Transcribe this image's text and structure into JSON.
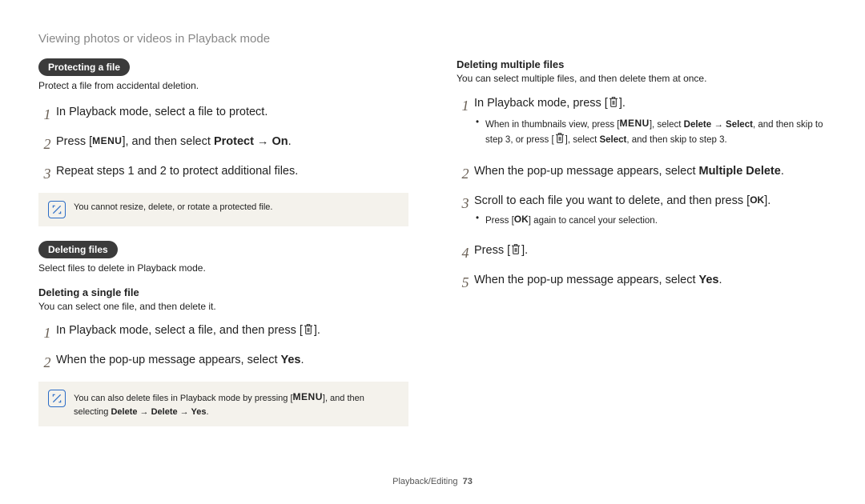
{
  "header": "Viewing photos or videos in Playback mode",
  "left": {
    "section1_title": "Protecting a file",
    "section1_intro": "Protect a file from accidental deletion.",
    "s1_step1": "In Playback mode, select a file to protect.",
    "s1_step2_a": "Press [",
    "s1_step2_menu": "MENU",
    "s1_step2_b": "], and then select ",
    "s1_step2_bold": "Protect → On",
    "s1_step2_c": ".",
    "s1_step3": "Repeat steps 1 and 2 to protect additional files.",
    "callout1": "You cannot resize, delete, or rotate a protected file.",
    "section2_title": "Deleting files",
    "section2_intro": "Select files to delete in Playback mode.",
    "sub_single_title": "Deleting a single file",
    "sub_single_intro": "You can select one file, and then delete it.",
    "s2_step1_a": "In Playback mode, select a file, and then press [",
    "s2_step1_b": "].",
    "s2_step2_a": "When the pop-up message appears, select ",
    "s2_step2_bold": "Yes",
    "s2_step2_b": ".",
    "callout2_a": "You can also delete files in Playback mode by pressing [",
    "callout2_menu": "MENU",
    "callout2_b": "], and then selecting ",
    "callout2_bold": "Delete → Delete → Yes",
    "callout2_c": "."
  },
  "right": {
    "sub_multi_title": "Deleting multiple files",
    "sub_multi_intro": "You can select multiple files, and then delete them at once.",
    "r_step1_a": "In Playback mode, press [",
    "r_step1_b": "].",
    "r_bullet1_a": "When in thumbnails view, press [",
    "r_bullet1_menu": "MENU",
    "r_bullet1_b": "], select ",
    "r_bullet1_bold1": "Delete → Select",
    "r_bullet1_c": ", and then skip to step 3, or press [",
    "r_bullet1_d": "], select ",
    "r_bullet1_bold2": "Select",
    "r_bullet1_e": ", and then skip to step 3.",
    "r_step2_a": "When the pop-up message appears, select ",
    "r_step2_bold": "Multiple Delete",
    "r_step2_b": ".",
    "r_step3_a": "Scroll to each file you want to delete, and then press [",
    "r_step3_ok": "OK",
    "r_step3_b": "].",
    "r_bullet2_a": "Press [",
    "r_bullet2_ok": "OK",
    "r_bullet2_b": "] again to cancel your selection.",
    "r_step4_a": "Press [",
    "r_step4_b": "].",
    "r_step5_a": "When the pop-up message appears, select ",
    "r_step5_bold": "Yes",
    "r_step5_b": "."
  },
  "footer_label": "Playback/Editing",
  "footer_page": "73"
}
